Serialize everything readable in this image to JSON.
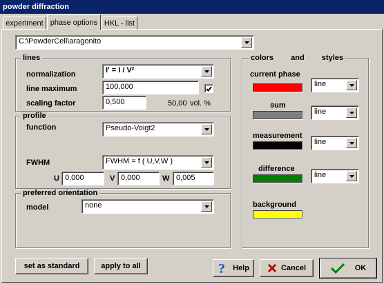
{
  "window": {
    "title": "powder diffraction"
  },
  "tabs": [
    {
      "label": "experiment"
    },
    {
      "label": "phase options"
    },
    {
      "label": "HKL - list"
    }
  ],
  "path": {
    "value": "C:\\PowderCell\\aragonito"
  },
  "lines": {
    "legend": "lines",
    "normalization": {
      "label": "normalization",
      "value": "I' = I / V²"
    },
    "line_maximum": {
      "label": "line maximum",
      "value": "100,000",
      "checked": true
    },
    "scaling_factor": {
      "label": "scaling factor",
      "value": "0,500",
      "vol_value": "50,00",
      "vol_unit": "vol. %"
    }
  },
  "profile": {
    "legend": "profile",
    "function": {
      "label": "function",
      "value": "Pseudo-Voigt2"
    },
    "fwhm": {
      "label": "FWHM",
      "value": "FWHM = f ( U,V,W )"
    },
    "u": {
      "label": "U",
      "value": "0,000"
    },
    "v": {
      "label": "V",
      "value": "0,000"
    },
    "w": {
      "label": "W",
      "value": "0,005"
    }
  },
  "preferred_orientation": {
    "legend": "preferred orientation",
    "model": {
      "label": "model",
      "value": "none"
    }
  },
  "colors": {
    "legend_words": [
      "colors",
      "and",
      "styles"
    ],
    "items": [
      {
        "label": "current phase",
        "color": "#ff0000",
        "style": "line"
      },
      {
        "label": "sum",
        "color": "#808080",
        "style": "line"
      },
      {
        "label": "measurement",
        "color": "#000000",
        "style": "line"
      },
      {
        "label": "difference",
        "color": "#008000",
        "style": "line"
      },
      {
        "label": "background",
        "color": "#ffff00"
      }
    ]
  },
  "buttons": {
    "set_as_standard": "set as standard",
    "apply_to_all": "apply to all",
    "help": "Help",
    "cancel": "Cancel",
    "ok": "OK"
  }
}
